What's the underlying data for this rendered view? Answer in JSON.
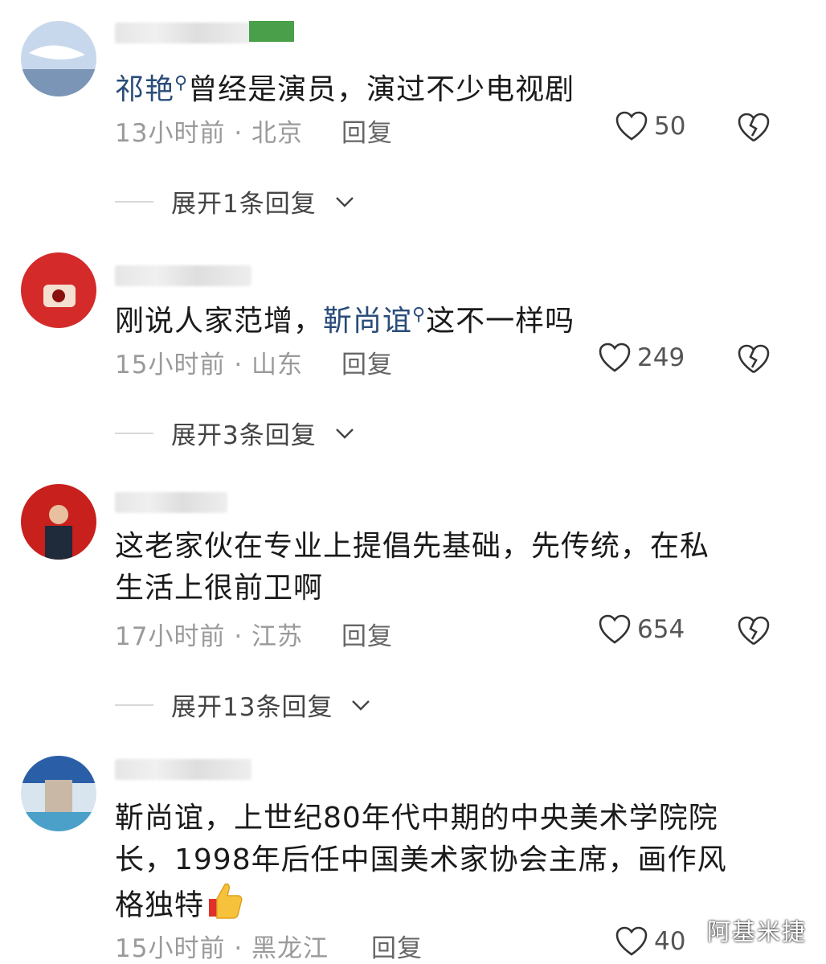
{
  "comments": [
    {
      "text_mention": "祁艳",
      "text_rest": "曾经是演员，演过不少电视剧",
      "time": "13小时前",
      "location": "北京",
      "reply_label": "回复",
      "likes": "50",
      "expand_label": "展开1条回复"
    },
    {
      "text_prefix": "刚说人家范增，",
      "text_mention": "靳尚谊",
      "text_rest": "这不一样吗",
      "time": "15小时前",
      "location": "山东",
      "reply_label": "回复",
      "likes": "249",
      "expand_label": "展开3条回复"
    },
    {
      "text_line1": "这老家伙在专业上提倡先基础，先传统，在私",
      "text_line2": "生活上很前卫啊",
      "time": "17小时前",
      "location": "江苏",
      "reply_label": "回复",
      "likes": "654",
      "expand_label": "展开13条回复"
    },
    {
      "text_line1": "靳尚谊，上世纪80年代中期的中央美术学院院",
      "text_line2": "长，1998年后任中国美术家协会主席，画作风",
      "text_line3": "格独特",
      "time": "15小时前",
      "location": "黑龙江",
      "reply_label": "回复",
      "likes": "40"
    }
  ],
  "separator": "·",
  "watermark": "阿基米捷",
  "icons": {
    "mention": "search-icon",
    "like": "heart-outline-icon",
    "dislike": "broken-heart-icon",
    "expand": "chevron-down-icon",
    "emoji": "thumbs-up-emoji"
  },
  "colors": {
    "mention": "#2a4d7a",
    "meta": "#9a9a9a",
    "text": "#1a1a1a"
  }
}
